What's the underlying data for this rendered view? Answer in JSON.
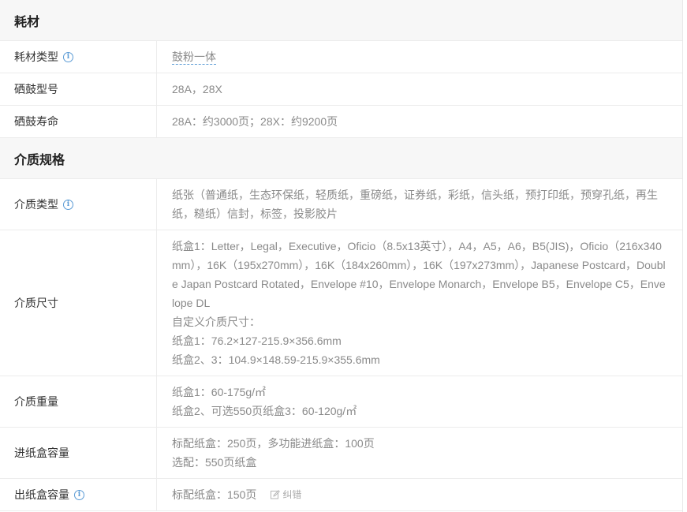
{
  "sections": {
    "consumables": {
      "title": "耗材",
      "rows": {
        "type": {
          "label": "耗材类型",
          "value": "鼓粉一体"
        },
        "model": {
          "label": "硒鼓型号",
          "value": "28A，28X"
        },
        "life": {
          "label": "硒鼓寿命",
          "value": "28A：约3000页；28X：约9200页"
        }
      }
    },
    "media": {
      "title": "介质规格",
      "rows": {
        "type": {
          "label": "介质类型",
          "lines": [
            "纸张（普通纸，生态环保纸，轻质纸，重磅纸，证券纸，彩纸，信头纸，预打印纸，预穿孔纸，再生纸，糙纸）信封，标签，投影胶片"
          ]
        },
        "size": {
          "label": "介质尺寸",
          "lines": [
            "纸盒1：Letter，Legal，Executive，Oficio（8.5x13英寸），A4，A5，A6，B5(JIS)，Oficio（216x340mm），16K（195x270mm），16K（184x260mm），16K（197x273mm），Japanese Postcard，Double Japan Postcard Rotated，Envelope #10，Envelope Monarch，Envelope B5，Envelope C5，Envelope DL",
            "自定义介质尺寸：",
            "纸盒1：76.2×127-215.9×356.6mm",
            "纸盒2、3：104.9×148.59-215.9×355.6mm"
          ]
        },
        "weight": {
          "label": "介质重量",
          "lines": [
            "纸盒1：60-175g/㎡",
            "纸盒2、可选550页纸盒3：60-120g/㎡"
          ]
        },
        "input": {
          "label": "进纸盒容量",
          "lines": [
            "标配纸盒：250页，多功能进纸盒：100页",
            "选配：550页纸盒"
          ]
        },
        "output": {
          "label": "出纸盒容量",
          "value": "标配纸盒：150页",
          "edit_label": "纠错"
        }
      }
    }
  },
  "icons": {
    "info": "info-circle-icon",
    "edit": "edit-pencil-icon"
  },
  "colors": {
    "accent": "#5b9bd5",
    "header_bg": "#f7f7f7",
    "value_text": "#8a8a8a"
  }
}
